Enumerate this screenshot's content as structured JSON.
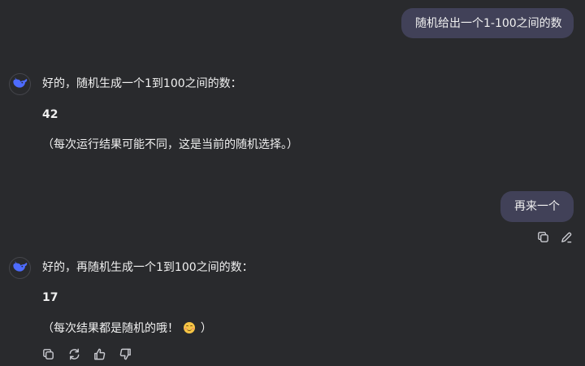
{
  "messages": {
    "user1": "随机给出一个1-100之间的数",
    "ai1": {
      "intro": "好的，随机生成一个1到100之间的数：",
      "number": "42",
      "note": "（每次运行结果可能不同，这是当前的随机选择。）"
    },
    "user2": "再来一个",
    "ai2": {
      "intro": "好的，再随机生成一个1到100之间的数：",
      "number": "17",
      "note_before": "（每次结果都是随机的哦！",
      "note_emoji": "smiling-face-emoji",
      "note_after": "）"
    }
  },
  "icons": {
    "avatar": "whale-logo-icon",
    "copy": "copy-icon",
    "edit": "edit-icon",
    "regenerate": "refresh-icon",
    "like": "thumbs-up-icon",
    "dislike": "thumbs-down-icon"
  },
  "colors": {
    "background": "#292a2d",
    "user_bubble": "#414158",
    "text": "#f0f0f0",
    "icon": "#c9cad0",
    "brand": "#4d6bfe"
  }
}
